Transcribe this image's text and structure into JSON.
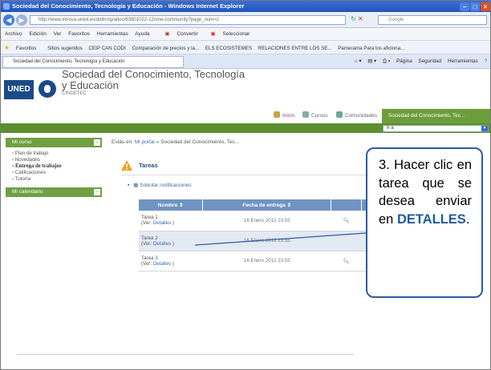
{
  "browser": {
    "title": "Sociedad del Conocimiento, Tecnología y Educación - Windows Internet Explorer",
    "url": "http://www.innova.uned.es/dotlrn/grados/63901022-12/one-community?page_num=2",
    "search_placeholder": "Google",
    "menu": [
      "Archivo",
      "Edición",
      "Ver",
      "Favoritos",
      "Herramientas",
      "Ayuda"
    ],
    "convert_label": "Convertir",
    "select_label": "Seleccionar",
    "favorites_label": "Favoritos",
    "favorites": [
      "Sitios sugeridos",
      "CEIP CAN CODI",
      "Comparación de precios y la...",
      "ELS ECOSISTEMES",
      "RELACIONES ENTRE LOS SE...",
      "Pamerama Para los aficiona..."
    ],
    "tab_title": "Sociedad del Conocimiento, Tecnología y Educación",
    "tools": [
      "Página",
      "Seguridad",
      "Herramientas"
    ]
  },
  "site": {
    "logo": "UNED",
    "title_line1": "Sociedad del Conocimiento, Tecnología",
    "title_line2": "y Educación",
    "subtitle": "CINDETEC",
    "nav": {
      "inicio": "Inicio",
      "cursos": "Cursos",
      "comunidades": "Comunidades",
      "active": "Sociedad del Conocimiento, Tec..."
    },
    "select_value": "Ir a"
  },
  "sidebar": {
    "mi_curso": "Mi curso",
    "items": [
      "Plan de trabajo",
      "Novedades",
      "Entrega de trabajos",
      "Calificaciones",
      "Tutoría"
    ],
    "mi_calendario": "Mi calendario"
  },
  "breadcrumb": {
    "prefix": "Estás en:",
    "link": "Mi portal",
    "rest": "» Sociedad del Conocimiento, Tec..."
  },
  "tareas": {
    "title": "Tareas",
    "notify": "Solicitar notificaciones",
    "headers": [
      "Nombre",
      "Fecha de entrega"
    ],
    "rows": [
      {
        "name": "Tarea 1",
        "ver": "(Ver:",
        "det": "Detalles",
        "close": ")",
        "date": "16 Enero 2012 23:55"
      },
      {
        "name": "Tarea 2",
        "ver": "(Ver:",
        "det": "Detalles",
        "close": ")",
        "date": "16 Enero 2012 23:55"
      },
      {
        "name": "Tarea 3",
        "ver": "(Ver:",
        "det": "Detalles",
        "close": ")",
        "date": "16 Enero 2012 23:55"
      }
    ]
  },
  "callout": {
    "text": "3. Hacer clic en tarea que se desea enviar en",
    "strong": "DETALLES",
    "end": "."
  }
}
